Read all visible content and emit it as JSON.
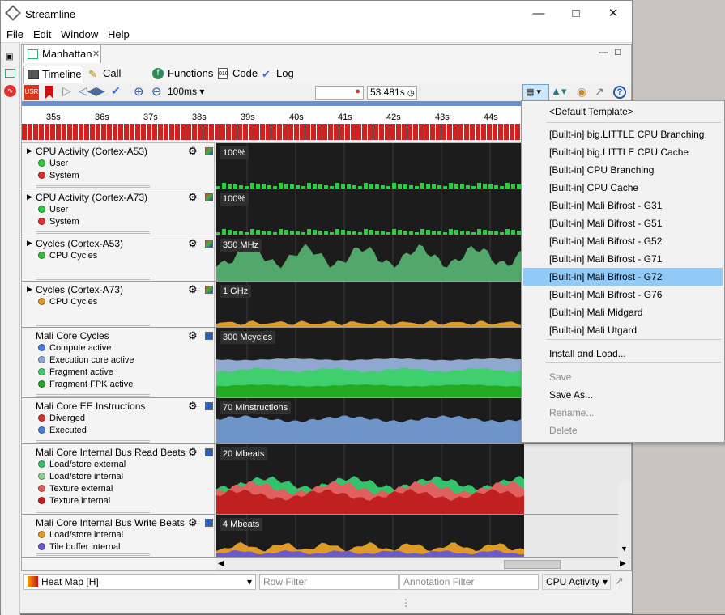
{
  "app": {
    "title": "Streamline"
  },
  "menubar": [
    "File",
    "Edit",
    "Window",
    "Help"
  ],
  "editor_tab": "Manhattan",
  "subtabs": [
    "Timeline",
    "Call Paths",
    "Functions",
    "Code",
    "Log"
  ],
  "toolbar": {
    "zoom": "100ms",
    "search_value": "",
    "time": "53.481s"
  },
  "ruler": {
    "ticks": [
      "35s",
      "36s",
      "37s",
      "38s",
      "39s",
      "40s",
      "41s",
      "42s",
      "43s",
      "44s"
    ]
  },
  "rows": [
    {
      "name": "CPU Activity (Cortex-A53)",
      "expandable": true,
      "max": "100%",
      "series": [
        {
          "label": "User",
          "color": "#2ecc40"
        },
        {
          "label": "System",
          "color": "#e03030"
        }
      ]
    },
    {
      "name": "CPU Activity (Cortex-A73)",
      "expandable": true,
      "max": "100%",
      "series": [
        {
          "label": "User",
          "color": "#2ecc40"
        },
        {
          "label": "System",
          "color": "#e03030"
        }
      ]
    },
    {
      "name": "Cycles (Cortex-A53)",
      "expandable": true,
      "max": "350 MHz",
      "series": [
        {
          "label": "CPU Cycles",
          "color": "#3dbd3d"
        }
      ]
    },
    {
      "name": "Cycles (Cortex-A73)",
      "expandable": true,
      "max": "1 GHz",
      "series": [
        {
          "label": "CPU Cycles",
          "color": "#e09a28"
        }
      ]
    },
    {
      "name": "Mali Core Cycles",
      "expandable": false,
      "max": "300 Mcycles",
      "series": [
        {
          "label": "Compute active",
          "color": "#4a7fd8"
        },
        {
          "label": "Execution core active",
          "color": "#8fa8d0"
        },
        {
          "label": "Fragment active",
          "color": "#3fcf6c"
        },
        {
          "label": "Fragment FPK active",
          "color": "#22aa22"
        }
      ]
    },
    {
      "name": "Mali Core EE Instructions",
      "expandable": false,
      "max": "70 Minstructions",
      "series": [
        {
          "label": "Diverged",
          "color": "#e03030"
        },
        {
          "label": "Executed",
          "color": "#4a7fd8"
        }
      ]
    },
    {
      "name": "Mali Core Internal Bus Read Beats",
      "expandable": false,
      "max": "20 Mbeats",
      "series": [
        {
          "label": "Load/store external",
          "color": "#36c26b"
        },
        {
          "label": "Load/store internal",
          "color": "#8fcf8f"
        },
        {
          "label": "Texture external",
          "color": "#e06060"
        },
        {
          "label": "Texture internal",
          "color": "#c02020"
        }
      ]
    },
    {
      "name": "Mali Core Internal Bus Write Beats",
      "expandable": false,
      "max": "4 Mbeats",
      "series": [
        {
          "label": "Load/store internal",
          "color": "#e09a28"
        },
        {
          "label": "Tile buffer internal",
          "color": "#6a5acd"
        }
      ]
    }
  ],
  "template_menu": {
    "items": [
      {
        "label": "<Default Template>",
        "state": "normal"
      },
      {
        "label": "[Built-in] big.LITTLE CPU Branching",
        "state": "normal"
      },
      {
        "label": "[Built-in] big.LITTLE CPU Cache",
        "state": "normal"
      },
      {
        "label": "[Built-in] CPU Branching",
        "state": "normal"
      },
      {
        "label": "[Built-in] CPU Cache",
        "state": "normal"
      },
      {
        "label": "[Built-in] Mali Bifrost - G31",
        "state": "normal"
      },
      {
        "label": "[Built-in] Mali Bifrost - G51",
        "state": "normal"
      },
      {
        "label": "[Built-in] Mali Bifrost - G52",
        "state": "normal"
      },
      {
        "label": "[Built-in] Mali Bifrost - G71",
        "state": "normal"
      },
      {
        "label": "[Built-in] Mali Bifrost - G72",
        "state": "selected"
      },
      {
        "label": "[Built-in] Mali Bifrost - G76",
        "state": "normal"
      },
      {
        "label": "[Built-in] Mali Midgard",
        "state": "normal"
      },
      {
        "label": "[Built-in] Mali Utgard",
        "state": "normal"
      },
      {
        "label": "Install and Load...",
        "state": "normal"
      },
      {
        "label": "Save",
        "state": "disabled"
      },
      {
        "label": "Save As...",
        "state": "normal"
      },
      {
        "label": "Rename...",
        "state": "disabled"
      },
      {
        "label": "Delete",
        "state": "disabled"
      }
    ]
  },
  "statusbar": {
    "mode": "Heat Map [H]",
    "row_filter_placeholder": "Row Filter",
    "annotation_filter_placeholder": "Annotation Filter",
    "selector": "CPU Activity"
  }
}
